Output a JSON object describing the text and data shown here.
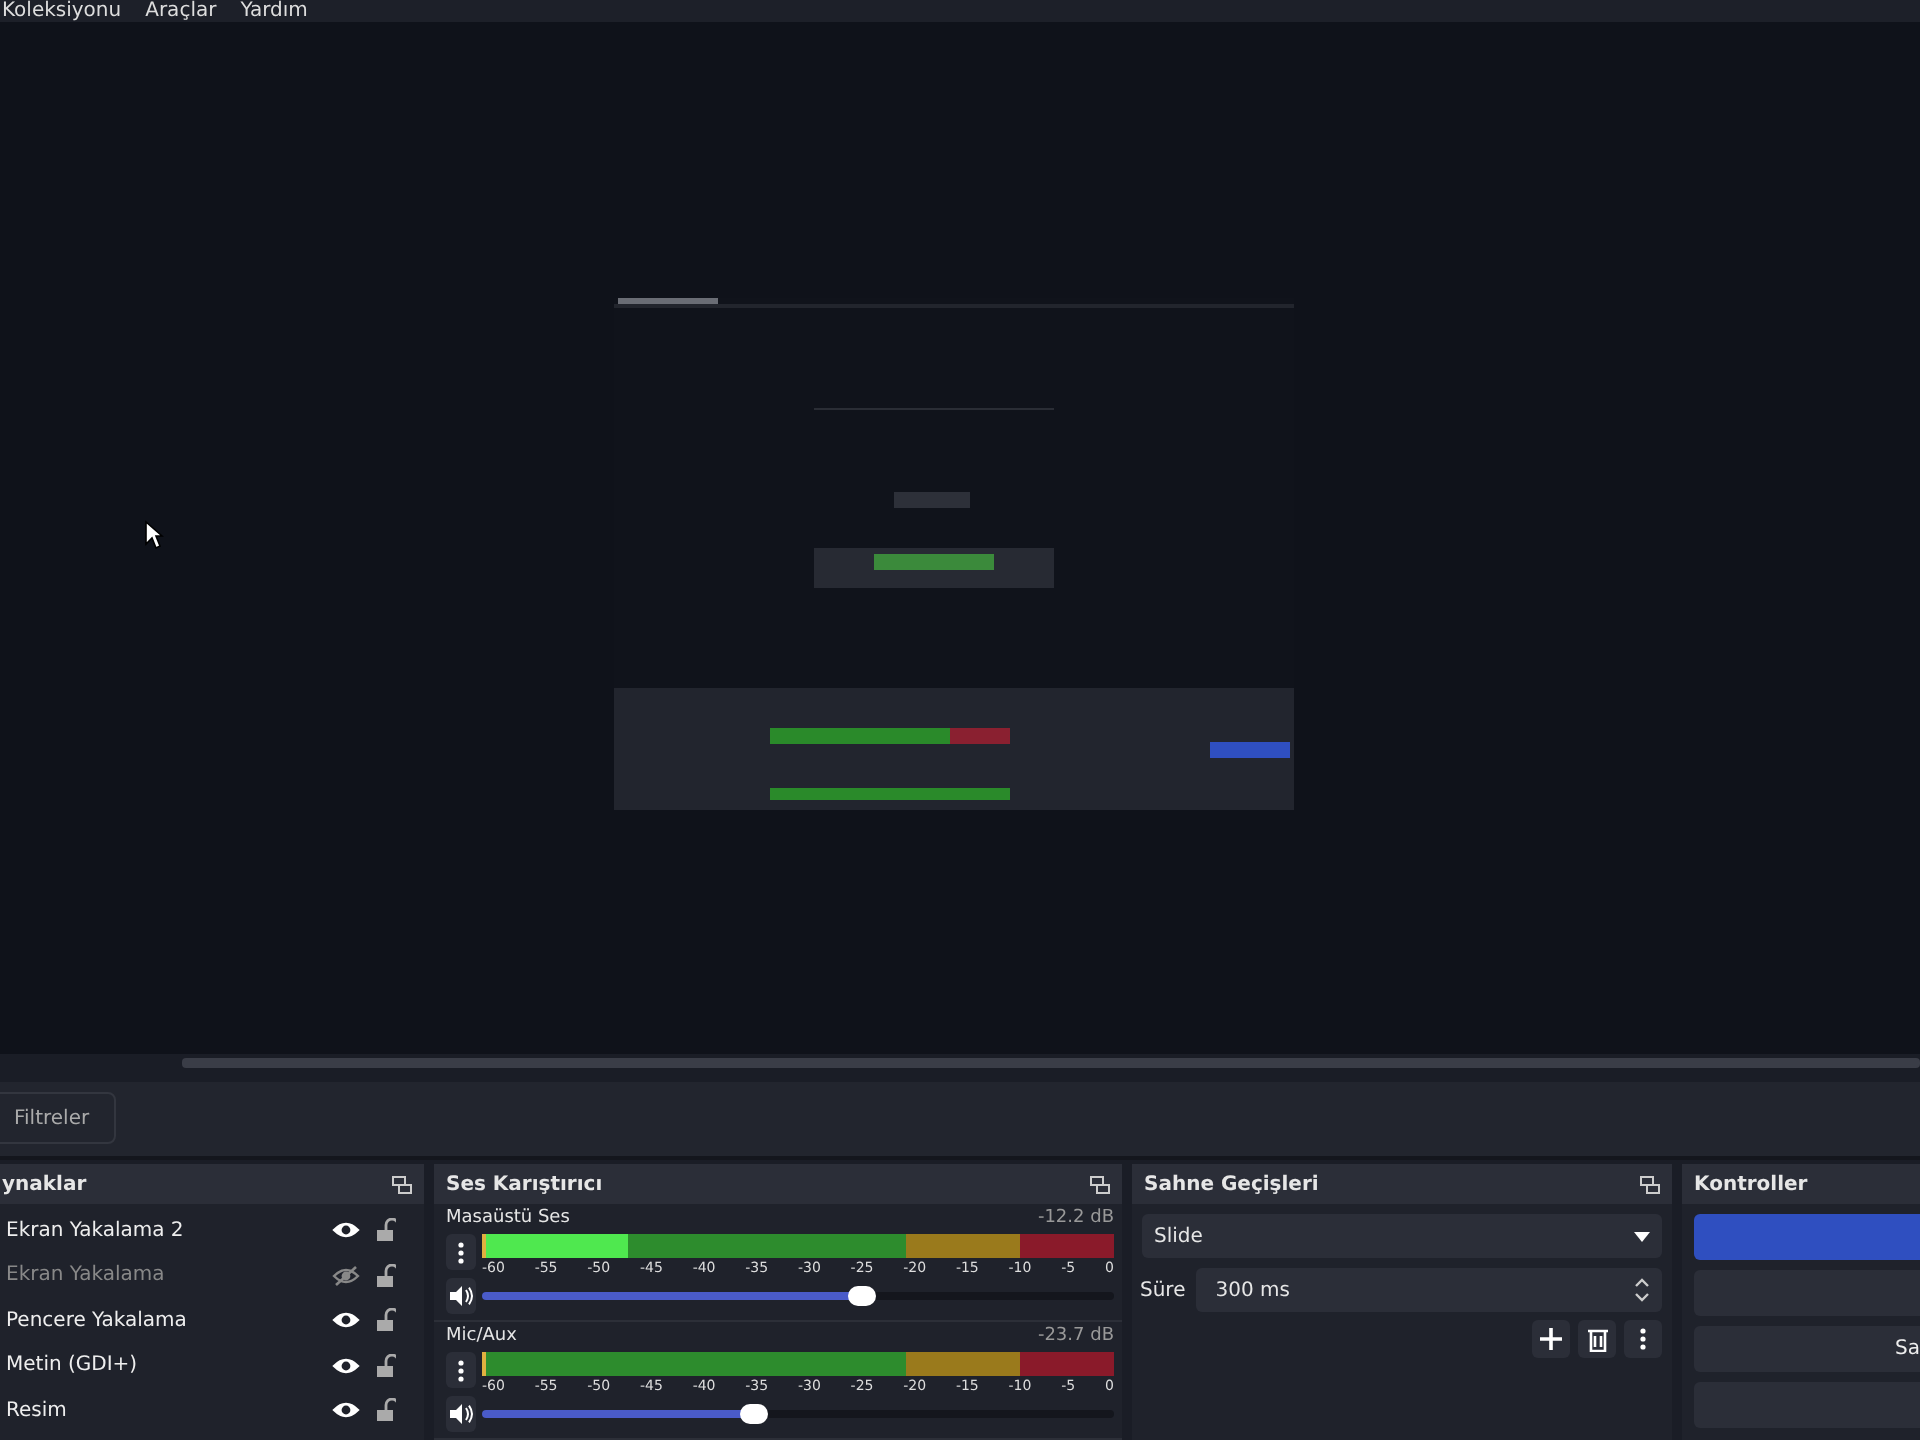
{
  "menu": [
    "Koleksiyonu",
    "Araçlar",
    "Yardım"
  ],
  "filter_button": "Filtreler",
  "sources": {
    "title": "ynaklar",
    "items": [
      {
        "name": "Ekran Yakalama 2",
        "visible": true,
        "locked": false
      },
      {
        "name": "Ekran Yakalama",
        "visible": false,
        "locked": false
      },
      {
        "name": "Pencere Yakalama",
        "visible": true,
        "locked": false
      },
      {
        "name": "Metin (GDI+)",
        "visible": true,
        "locked": false
      },
      {
        "name": "Resim",
        "visible": true,
        "locked": false
      }
    ]
  },
  "mixer": {
    "title": "Ses Karıştırıcı",
    "channels": [
      {
        "name": "Masaüstü Ses",
        "reading": "-12.2 dB",
        "level": 0.23,
        "volume": {
          "level": 0.6
        },
        "ticks": [
          "-60",
          "-55",
          "-50",
          "-45",
          "-40",
          "-35",
          "-30",
          "-25",
          "-20",
          "-15",
          "-10",
          "-5",
          "0"
        ]
      },
      {
        "name": "Mic/Aux",
        "reading": "-23.7 dB",
        "level": 0.0,
        "volume": {
          "level": 0.43
        },
        "ticks": [
          "-60",
          "-55",
          "-50",
          "-45",
          "-40",
          "-35",
          "-30",
          "-25",
          "-20",
          "-15",
          "-10",
          "-5",
          "0"
        ]
      }
    ]
  },
  "transitions": {
    "title": "Sahne Geçişleri",
    "type": "Slide",
    "duration_label": "Süre",
    "duration": "300 ms"
  },
  "controls": {
    "title": "Kontroller",
    "buttons": [
      {
        "selected": true
      },
      {
        "selected": false
      },
      {
        "label": "Sa",
        "selected": false
      },
      {
        "selected": false
      }
    ]
  }
}
